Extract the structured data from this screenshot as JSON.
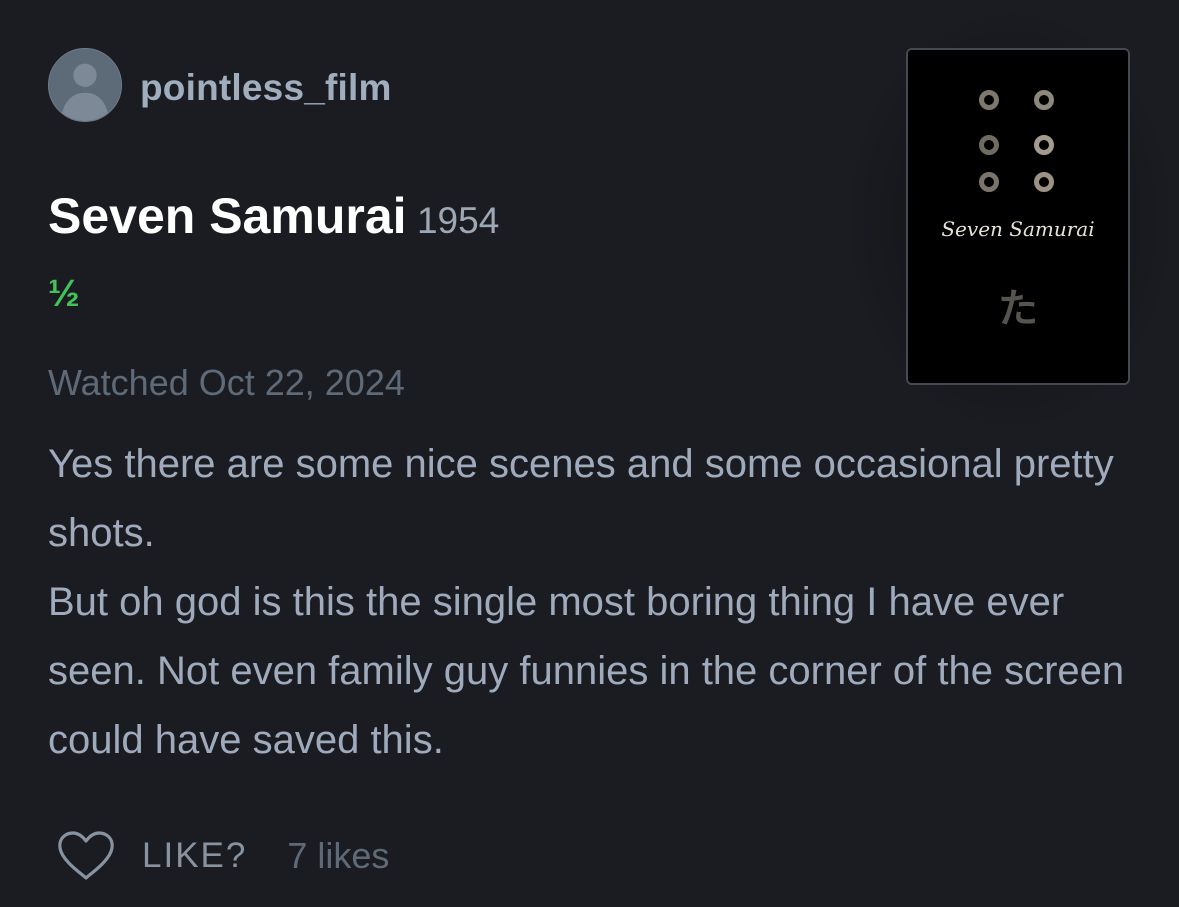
{
  "review": {
    "username": "pointless_film",
    "film_title": "Seven Samurai",
    "film_year": "1954",
    "rating": "½",
    "watched_date": "Watched Oct 22, 2024",
    "paragraphs": [
      "Yes there are some nice scenes and some occasional pretty shots.",
      "But oh god is this the single most boring thing I have ever seen. Not even family guy funnies in the corner of the screen could have saved this."
    ]
  },
  "poster": {
    "title_text": "Seven Samurai",
    "glyph": "た"
  },
  "actions": {
    "like_label": "LIKE?",
    "likes_count": "7 likes"
  },
  "icons": {
    "avatar": "user-silhouette-icon",
    "like": "heart-outline-icon"
  },
  "colors": {
    "background": "#1a1c21",
    "rating_green": "#40c45a",
    "text_muted": "#9fabbc"
  }
}
